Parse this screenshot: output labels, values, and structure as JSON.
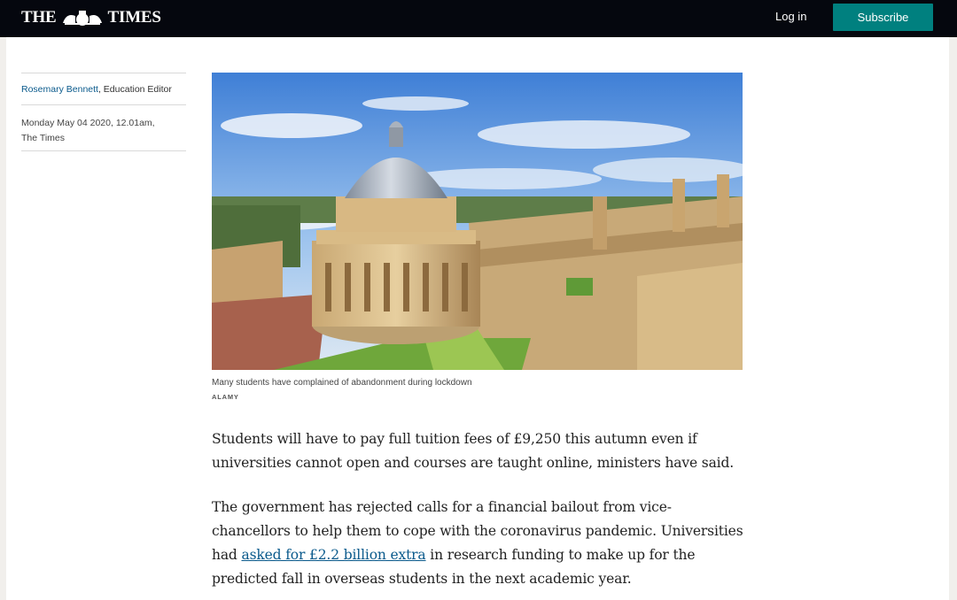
{
  "header": {
    "masthead_left": "THE",
    "masthead_right": "TIMES",
    "crest_icon": "royal-crest-icon",
    "login_label": "Log in",
    "subscribe_label": "Subscribe",
    "subscribe_color": "#00807f",
    "bar_color": "#05070e"
  },
  "byline": {
    "author": "Rosemary Bennett",
    "role": ", Education Editor",
    "date_line1": "Monday May 04 2020, 12.01am,",
    "date_line2": "The Times"
  },
  "image": {
    "caption": "Many students have complained of abandonment during lockdown",
    "credit": "ALAMY"
  },
  "article": {
    "p1": "Students will have to pay full tuition fees of £9,250 this autumn even if universities cannot open and courses are taught online, ministers have said.",
    "p2_before": "The government has rejected calls for a financial bailout from vice-chancellors to help them to cope with the coronavirus pandemic. Universities had ",
    "p2_link": "asked for £2.2 billion extra",
    "p2_after": " in research funding to make up for the predicted fall in overseas students in the next academic year."
  }
}
